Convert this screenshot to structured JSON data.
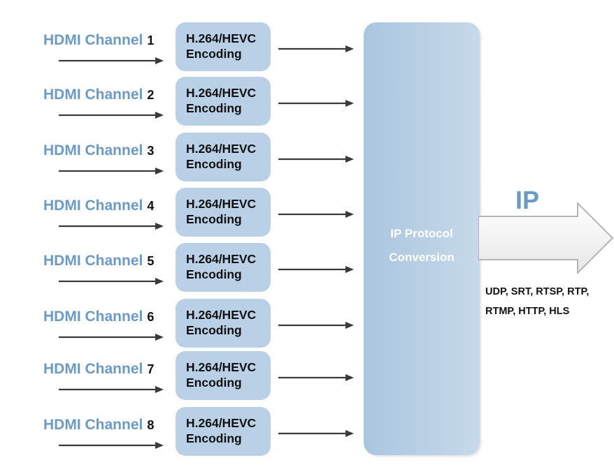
{
  "channels": [
    {
      "label": "HDMI Channel",
      "number": "1",
      "encoder": [
        "H.264/HEVC",
        "Encoding"
      ]
    },
    {
      "label": "HDMI Channel",
      "number": "2",
      "encoder": [
        "H.264/HEVC",
        "Encoding"
      ]
    },
    {
      "label": "HDMI Channel",
      "number": "3",
      "encoder": [
        "H.264/HEVC",
        "Encoding"
      ]
    },
    {
      "label": "HDMI Channel",
      "number": "4",
      "encoder": [
        "H.264/HEVC",
        "Encoding"
      ]
    },
    {
      "label": "HDMI Channel",
      "number": "5",
      "encoder": [
        "H.264/HEVC",
        "Encoding"
      ]
    },
    {
      "label": "HDMI Channel",
      "number": "6",
      "encoder": [
        "H.264/HEVC",
        "Encoding"
      ]
    },
    {
      "label": "HDMI Channel",
      "number": "7",
      "encoder": [
        "H.264/HEVC",
        "Encoding"
      ]
    },
    {
      "label": "HDMI Channel",
      "number": "8",
      "encoder": [
        "H.264/HEVC",
        "Encoding"
      ]
    }
  ],
  "converter": {
    "line1": "IP Protocol",
    "line2": "Conversion"
  },
  "output": {
    "title": "IP",
    "protocols_line1": "UDP, SRT, RTSP, RTP,",
    "protocols_line2": "RTMP, HTTP, HLS"
  },
  "colors": {
    "label_blue": "#6a9bc8",
    "box_blue": "#b9d0e6",
    "arrow_dark": "#3a3a3a"
  }
}
